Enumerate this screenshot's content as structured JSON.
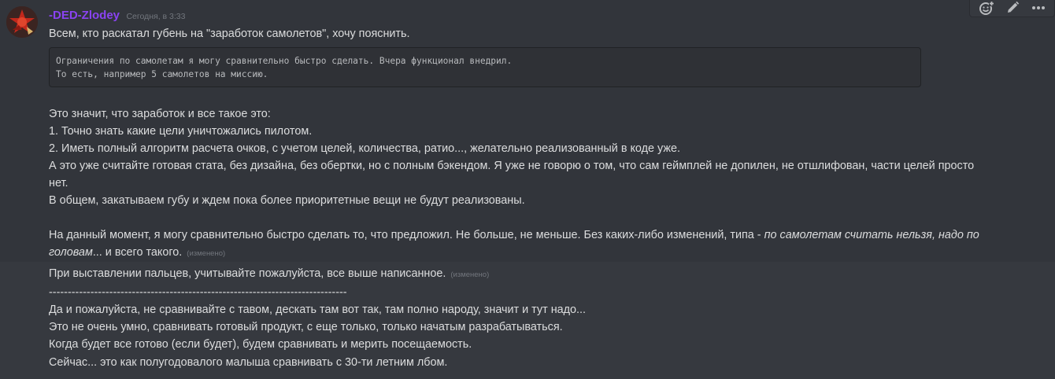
{
  "message": {
    "username": "-DED-Zlodey",
    "timestamp": "Сегодня, в 3:33",
    "line1": "Всем, кто раскатал губень на \"заработок самолетов\", хочу пояснить.",
    "code_line1": "Ограничения по самолетам я могу сравнительно быстро сделать. Вчера функционал внедрил.",
    "code_line2": "То есть, например 5 самолетов на миссию.",
    "p1": "Это значит, что заработок и все такое это:",
    "p2": "1. Точно знать какие цели уничтожались пилотом.",
    "p3": "2. Иметь полный алгоритм расчета очков, с учетом целей, количества, ратио..., желательно реализованный в коде уже.",
    "p4a": "А это уже считайте готовая стата, без дизайна, без обертки, но с полным бэкендом. Я уже не говорю о том, что сам геймплей не допилен, не отшлифован, части целей просто",
    "p4b": "нет.",
    "p5": "В общем, закатываем губу и ждем пока более приоритетные вещи не будут реализованы.",
    "p6a_plain": "На данный момент, я могу сравнительно быстро сделать то, что предложил. Не больше, не меньше. Без каких-либо изменений, типа - ",
    "p6a_italic": "по самолетам считать нельзя, надо по",
    "p6b_italic": "головам",
    "p6b_plain": "... и всего такого.",
    "edited_label_1": "(изменено)"
  },
  "message2": {
    "line1": "При выставлении пальцев, учитывайте пожалуйста, все выше написанное.",
    "edited_label": "(изменено)",
    "separator": "-------------------------------------------------------------------------------",
    "line2": "Да и пожалуйста, не сравнивайте с тавом, дескать там вот так, там полно народу, значит и тут надо...",
    "line3": "Это не очень умно, сравнивать готовый продукт, с еще только, только начатым разрабатываться.",
    "line4": "Когда будет все готово (если будет), будем сравнивать и мерить посещаемость.",
    "line5": "Сейчас...  это как полугодовалого малыша сравнивать с 30-ти летним лбом."
  },
  "toolbar": {
    "icons": [
      "add-reaction-icon",
      "edit-icon",
      "more-icon"
    ]
  },
  "colors": {
    "background": "#36393f",
    "hover_background": "#32353b",
    "username": "#8a43f2",
    "text": "#dcddde",
    "muted": "#72767d"
  }
}
